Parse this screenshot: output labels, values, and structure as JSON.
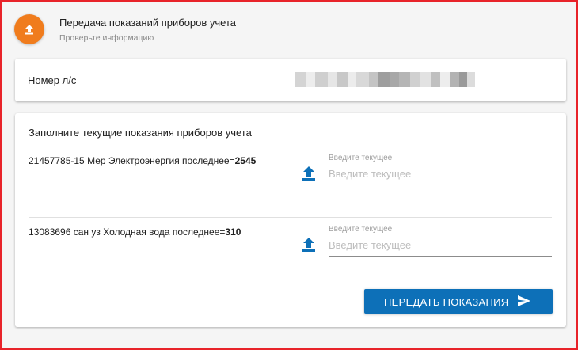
{
  "header": {
    "icon": "upload-icon",
    "title": "Передача показаний приборов учета",
    "subtitle": "Проверьте информацию"
  },
  "account": {
    "label": "Номер л/с",
    "value_state": "blurred"
  },
  "meters": {
    "title": "Заполните текущие показания приборов учета",
    "items": [
      {
        "description": "21457785-15 Мер Электроэнергия последнее=",
        "last_value": "2545",
        "upload_icon": "upload-icon",
        "input_label": "Введите текущее",
        "input_placeholder": "Введите текущее",
        "input_value": ""
      },
      {
        "description": "13083696 сан уз Холодная вода последнее=",
        "last_value": "310",
        "upload_icon": "upload-icon",
        "input_label": "Введите текущее",
        "input_placeholder": "Введите текущее",
        "input_value": ""
      }
    ]
  },
  "submit": {
    "label": "ПЕРЕДАТЬ ПОКАЗАНИЯ",
    "icon": "send-icon"
  },
  "colors": {
    "frame_border": "#e8232a",
    "header_icon_bg": "#f07c1d",
    "primary": "#0d70b8"
  }
}
